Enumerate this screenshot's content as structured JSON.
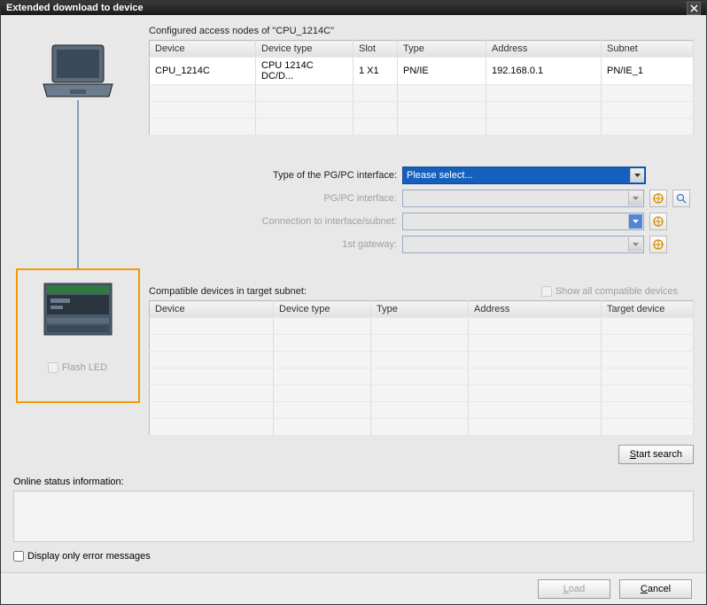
{
  "title": "Extended download to device",
  "configured_label": "Configured access nodes of \"CPU_1214C\"",
  "table1": {
    "headers": [
      "Device",
      "Device type",
      "Slot",
      "Type",
      "Address",
      "Subnet"
    ],
    "rows": [
      [
        "CPU_1214C",
        "CPU 1214C DC/D...",
        "1 X1",
        "PN/IE",
        "192.168.0.1",
        "PN/IE_1"
      ]
    ]
  },
  "form": {
    "row1_label": "Type of the PG/PC interface:",
    "row1_value": "Please select...",
    "row2_label": "PG/PC interface:",
    "row3_label": "Connection to interface/subnet:",
    "row4_label": "1st gateway:"
  },
  "compat_label": "Compatible devices in target subnet:",
  "show_all_label": "Show all compatible devices",
  "table2": {
    "headers": [
      "Device",
      "Device type",
      "Type",
      "Address",
      "Target device"
    ]
  },
  "flash_label": "Flash LED",
  "start_search": "Start search",
  "status_label": "Online status information:",
  "display_errors": "Display only error messages",
  "load_btn": "Load",
  "cancel_btn": "Cancel"
}
